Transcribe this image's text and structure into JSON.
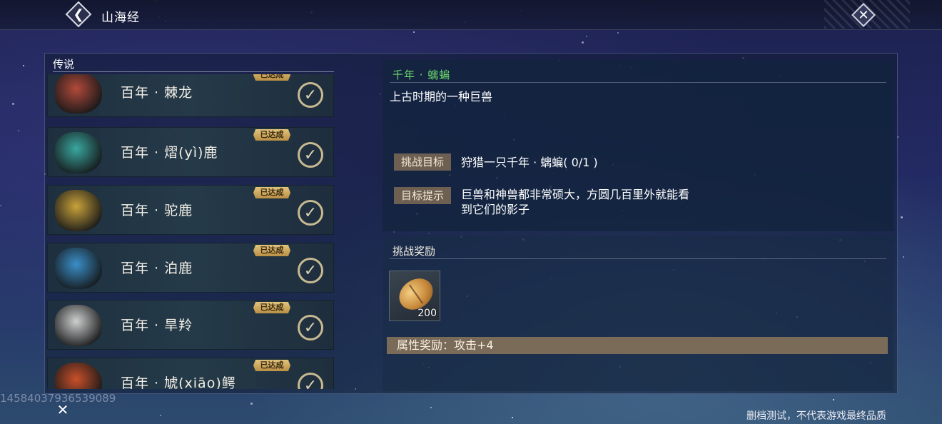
{
  "header": {
    "title": "山海经",
    "back_icon": "chevron-left-icon",
    "close_icon": "close-icon"
  },
  "list": {
    "section_label": "传说",
    "items": [
      {
        "name": "百年 · 棘龙",
        "status": "已达成",
        "portrait_color": "#b24a3a"
      },
      {
        "name": "百年 · 熠(yì)鹿",
        "status": "已达成",
        "portrait_color": "#3aa7a0"
      },
      {
        "name": "百年 · 驼鹿",
        "status": "已达成",
        "portrait_color": "#c9a23a"
      },
      {
        "name": "百年 · 泊鹿",
        "status": "已达成",
        "portrait_color": "#3a8fc9"
      },
      {
        "name": "百年 · 旱羚",
        "status": "已达成",
        "portrait_color": "#cfcfcf"
      },
      {
        "name": "百年 · 虓(xiāo)鳄",
        "status": "已达成",
        "portrait_color": "#c9502a"
      }
    ]
  },
  "detail": {
    "title": "千年 · 螭蝙",
    "description": "上古时期的一种巨兽",
    "goal_label": "挑战目标",
    "goal_text": "狩猎一只千年 · 螭蝙( 0/1 )",
    "hint_label": "目标提示",
    "hint_line1": "巨兽和神兽都非常硕大，方圆几百里外就能看",
    "hint_line2": "到它们的影子"
  },
  "reward": {
    "title": "挑战奖励",
    "item_icon": "seed-icon",
    "item_qty": "200",
    "attribute_text": "属性奖励：攻击+4"
  },
  "overlay": {
    "id_text": "1458403793653908​9",
    "footer_note": "删档测试，不代表游戏最终品质"
  },
  "colors": {
    "accent_green": "#6cd86c",
    "tag_gold": "#d8b765",
    "label_brown": "#6d6052"
  }
}
